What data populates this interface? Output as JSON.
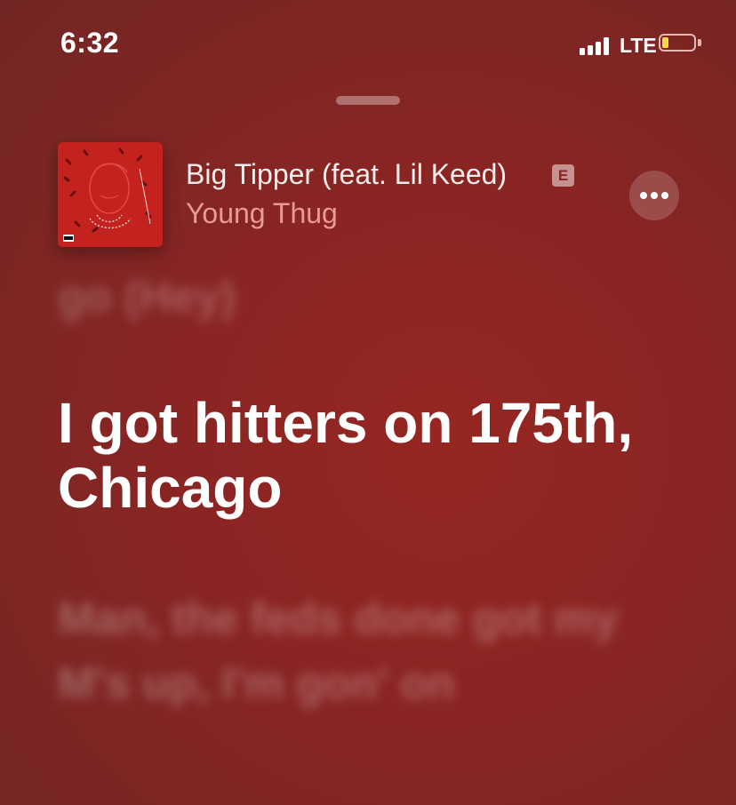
{
  "status_bar": {
    "time": "6:32",
    "network": "LTE",
    "battery_level": 0.2,
    "battery_color": "#f6d64a"
  },
  "now_playing": {
    "title": "Big Tipper (feat. Lil Keed)",
    "explicit_badge": "E",
    "artist": "Young Thug",
    "artwork_icon": "album-artwork-icon",
    "more_icon": "ellipsis-icon"
  },
  "lyrics": {
    "previous": "go (Hey)",
    "current": "I got hitters on 175th, Chicago",
    "next": "Man, the feds done got my M's up, I'm gon' on"
  },
  "colors": {
    "background": "#8a2523",
    "artist_text": "#e89b92"
  }
}
